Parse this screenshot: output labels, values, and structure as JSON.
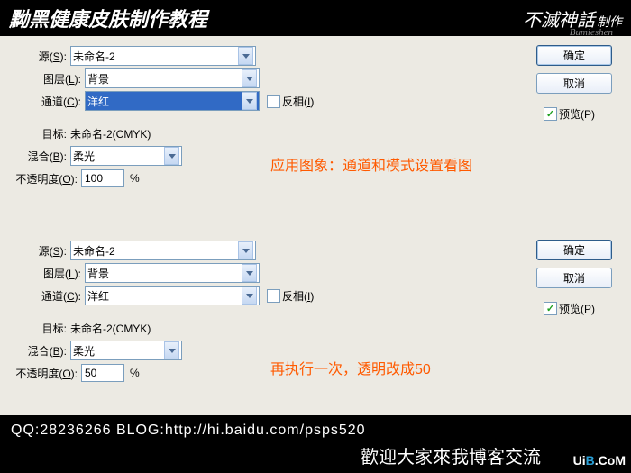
{
  "header": {
    "title": "黝黑健康皮肤制作教程",
    "logo": "不滅神話",
    "logo_sub": "制作",
    "logo_en": "Bumieshen"
  },
  "dialog1": {
    "source_label": "源(S):",
    "source_value": "未命名-2",
    "layer_label": "图层(L):",
    "layer_value": "背景",
    "channel_label": "通道(C):",
    "channel_value": "洋红",
    "invert_label": "反相(I)",
    "target_label": "目标:",
    "target_value": "未命名-2(CMYK)",
    "blend_label": "混合(B):",
    "blend_value": "柔光",
    "opacity_label": "不透明度(O):",
    "opacity_value": "100",
    "opacity_unit": "%",
    "ok": "确定",
    "cancel": "取消",
    "preview": "预览(P)",
    "annotation": "应用图象：通道和模式设置看图"
  },
  "dialog2": {
    "source_label": "源(S):",
    "source_value": "未命名-2",
    "layer_label": "图层(L):",
    "layer_value": "背景",
    "channel_label": "通道(C):",
    "channel_value": "洋红",
    "invert_label": "反相(I)",
    "target_label": "目标:",
    "target_value": "未命名-2(CMYK)",
    "blend_label": "混合(B):",
    "blend_value": "柔光",
    "opacity_label": "不透明度(O):",
    "opacity_value": "50",
    "opacity_unit": "%",
    "ok": "确定",
    "cancel": "取消",
    "preview": "预览(P)",
    "annotation": "再执行一次，透明改成50"
  },
  "footer": {
    "line1": "QQ:28236266    BLOG:http://hi.baidu.com/psps520",
    "line2": "歡迎大家來我博客交流"
  },
  "watermark": {
    "a": "Ui",
    "b": "B",
    "c": ".CoM"
  }
}
